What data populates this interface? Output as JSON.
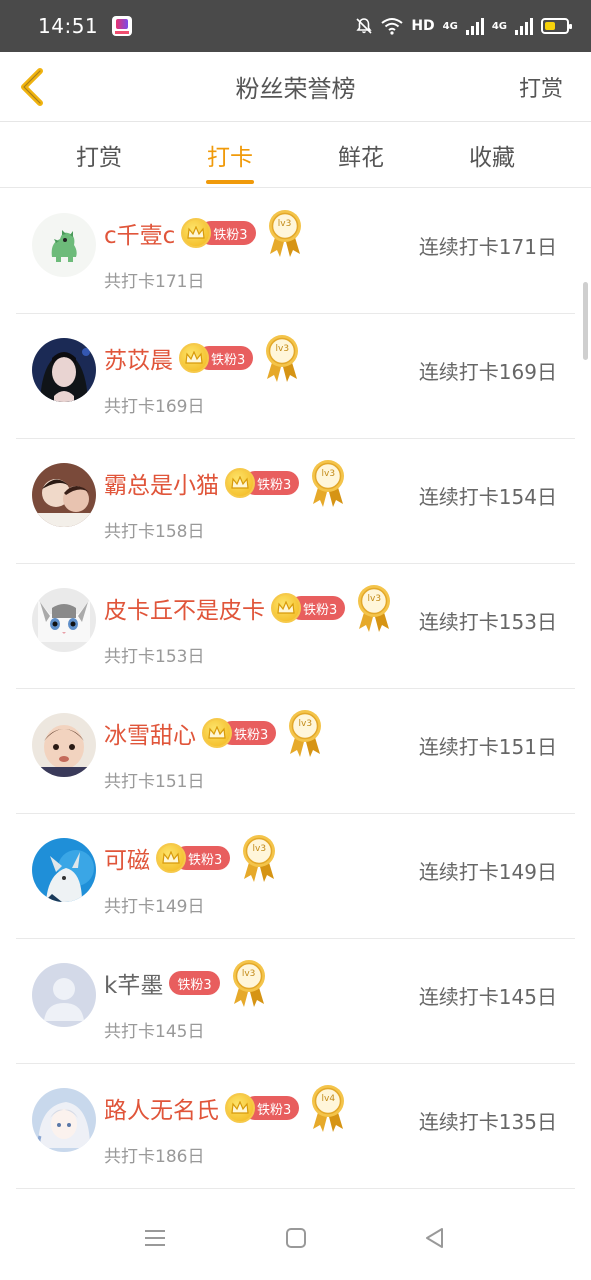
{
  "status": {
    "time": "14:51",
    "network": "HD",
    "sig1": "4G",
    "sig2": "4G"
  },
  "header": {
    "title": "粉丝荣誉榜",
    "right_action": "打赏"
  },
  "tabs": [
    {
      "label": "打赏",
      "active": false
    },
    {
      "label": "打卡",
      "active": true
    },
    {
      "label": "鲜花",
      "active": false
    },
    {
      "label": "收藏",
      "active": false
    }
  ],
  "colors": {
    "accent": "#f09a0a",
    "name_red": "#e0553a",
    "badge_red": "#e85e5e"
  },
  "fans": [
    {
      "name": "c千壹c",
      "has_crown": true,
      "fan_badge": "铁粉3",
      "level": "lv3",
      "total": "共打卡171日",
      "streak": "连续打卡171日",
      "name_colored": true
    },
    {
      "name": "苏苡晨",
      "has_crown": true,
      "fan_badge": "铁粉3",
      "level": "lv3",
      "total": "共打卡169日",
      "streak": "连续打卡169日",
      "name_colored": true
    },
    {
      "name": "霸总是小猫",
      "has_crown": true,
      "fan_badge": "铁粉3",
      "level": "lv3",
      "total": "共打卡158日",
      "streak": "连续打卡154日",
      "name_colored": true
    },
    {
      "name": "皮卡丘不是皮卡",
      "has_crown": true,
      "fan_badge": "铁粉3",
      "level": "lv3",
      "total": "共打卡153日",
      "streak": "连续打卡153日",
      "name_colored": true
    },
    {
      "name": "冰雪甜心",
      "has_crown": true,
      "fan_badge": "铁粉3",
      "level": "lv3",
      "total": "共打卡151日",
      "streak": "连续打卡151日",
      "name_colored": true
    },
    {
      "name": "可磁",
      "has_crown": true,
      "fan_badge": "铁粉3",
      "level": "lv3",
      "total": "共打卡149日",
      "streak": "连续打卡149日",
      "name_colored": true
    },
    {
      "name": "k芊墨",
      "has_crown": false,
      "fan_badge": "铁粉3",
      "level": "lv3",
      "total": "共打卡145日",
      "streak": "连续打卡145日",
      "name_colored": false
    },
    {
      "name": "路人无名氏",
      "has_crown": true,
      "fan_badge": "铁粉3",
      "level": "lv4",
      "total": "共打卡186日",
      "streak": "连续打卡135日",
      "name_colored": true
    }
  ]
}
